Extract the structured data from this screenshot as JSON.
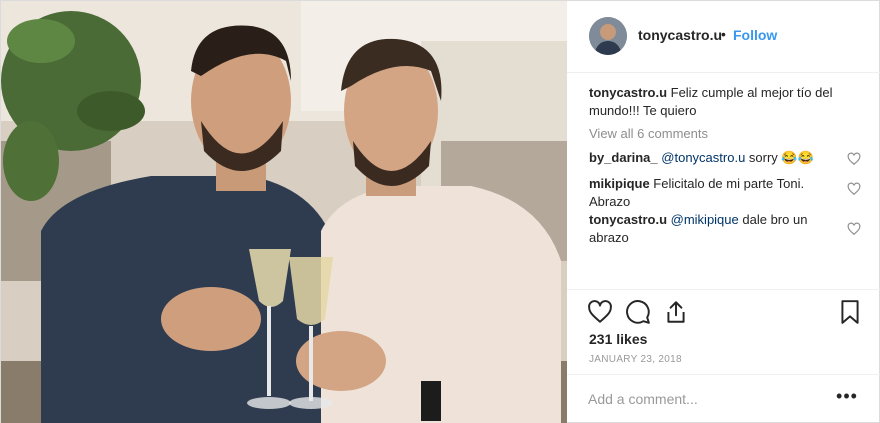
{
  "post": {
    "username": "tonycastro.u",
    "separator": "•",
    "follow_label": "Follow",
    "caption": {
      "username": "tonycastro.u",
      "text": " Feliz cumple al mejor tío del mundo!!! Te quiero"
    },
    "view_all_comments": "View all 6 comments",
    "comments": [
      {
        "username": "by_darina_",
        "mention": "@tonycastro.u",
        "text": " sorry 😂😂"
      },
      {
        "username": "mikipique",
        "mention": "",
        "text": " Felicitalo de mi parte Toni. Abrazo"
      },
      {
        "username": "tonycastro.u",
        "mention": "@mikipique",
        "text": " dale bro un abrazo"
      }
    ],
    "likes": "231 likes",
    "date": "JANUARY 23, 2018",
    "add_comment_placeholder": "Add a comment...",
    "more_label": "•••"
  },
  "icons": {
    "avatar": "profile-avatar",
    "comment_like": "heart-outline-icon",
    "like": "heart-outline-icon",
    "comment": "speech-bubble-icon",
    "share": "share-upload-icon",
    "save": "bookmark-icon"
  },
  "colors": {
    "link_blue": "#3897f0",
    "mention_blue": "#003569",
    "muted_gray": "#8e8e8e",
    "border": "#efefef"
  }
}
